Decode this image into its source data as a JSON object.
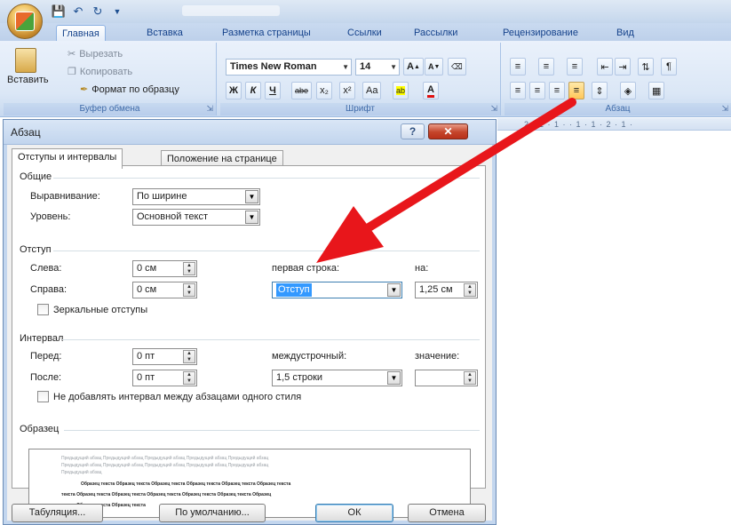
{
  "quick_access": {
    "save_icon": "save-icon",
    "undo_icon": "undo-icon",
    "redo_icon": "redo-icon"
  },
  "tabs": [
    "Главная",
    "Вставка",
    "Разметка страницы",
    "Ссылки",
    "Рассылки",
    "Рецензирование",
    "Вид"
  ],
  "ribbon": {
    "clipboard": {
      "paste": "Вставить",
      "cut": "Вырезать",
      "copy": "Копировать",
      "format_painter": "Формат по образцу",
      "title": "Буфер обмена"
    },
    "font": {
      "name": "Times New Roman",
      "size": "14",
      "grow": "A",
      "shrink": "A",
      "bold": "Ж",
      "italic": "К",
      "underline": "Ч",
      "strike": "abe",
      "subscript": "x₂",
      "superscript": "x²",
      "case": "Aa",
      "highlight": "ab",
      "color": "A",
      "title": "Шрифт"
    },
    "paragraph": {
      "title": "Абзац"
    }
  },
  "ruler": {
    "text": "2 · 1 · 1 ·   · 1 · 1 · 2 · 1 ·"
  },
  "dialog": {
    "title": "Абзац",
    "help": "?",
    "close": "✕",
    "tabs": [
      "Отступы и интервалы",
      "Положение на странице"
    ],
    "general": {
      "label": "Общие",
      "alignment_label": "Выравнивание:",
      "alignment_value": "По ширине",
      "level_label": "Уровень:",
      "level_value": "Основной текст"
    },
    "indent": {
      "label": "Отступ",
      "left_label": "Слева:",
      "left_value": "0 см",
      "right_label": "Справа:",
      "right_value": "0 см",
      "first_line_label": "первая строка:",
      "first_line_value": "Отступ",
      "by_label": "на:",
      "by_value": "1,25 см",
      "mirror_label": "Зеркальные отступы"
    },
    "spacing": {
      "label": "Интервал",
      "before_label": "Перед:",
      "before_value": "0 пт",
      "after_label": "После:",
      "after_value": "0 пт",
      "line_label": "междустрочный:",
      "line_value": "1,5 строки",
      "at_label": "значение:",
      "at_value": "",
      "no_space_label": "Не добавлять интервал между абзацами одного стиля"
    },
    "preview": {
      "label": "Образец",
      "prev_line1": "Предыдущий абзац Предыдущий абзац Предыдущий абзац Предыдущий абзац Предыдущий абзац",
      "prev_line2": "Предыдущий абзац Предыдущий абзац Предыдущий абзац Предыдущий абзац Предыдущий абзац",
      "prev_line3": "Предыдущий абзац",
      "sample_line1": "Образец текста Образец текста Образец текста Образец текста Образец текста Образец текста",
      "sample_line2": "текста Образец текста Образец текста Образец текста Образец текста Образец текста Образец",
      "sample_line3": "текста Образец текста Образец текста"
    },
    "buttons": {
      "tabs": "Табуляция...",
      "default": "По умолчанию...",
      "ok": "ОК",
      "cancel": "Отмена"
    }
  },
  "colors": {
    "arrow": "#e8161b",
    "ribbon_text": "#15428b",
    "selection": "#3399ff"
  }
}
